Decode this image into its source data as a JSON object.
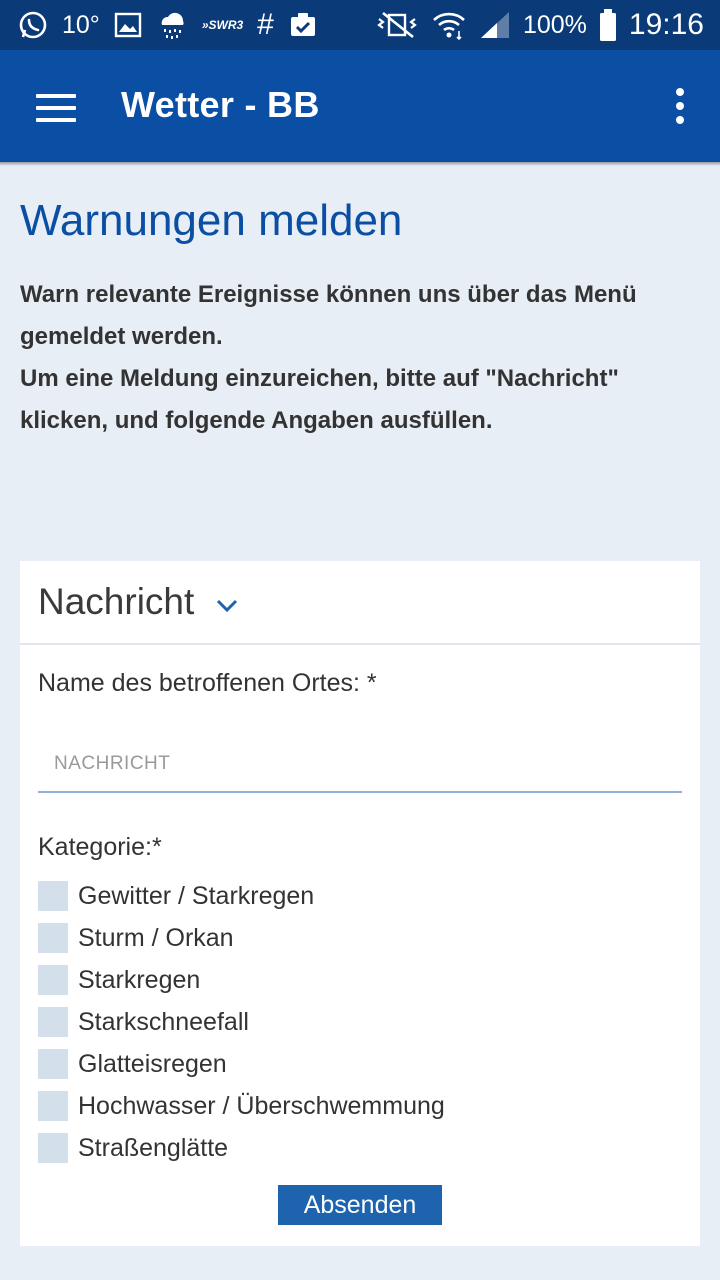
{
  "status_bar": {
    "temperature": "10°",
    "swr_label": "»SWR3",
    "hash": "#",
    "battery": "100%",
    "time": "19:16",
    "icons": [
      "whatsapp-icon",
      "gallery-icon",
      "weather-rain-icon",
      "swr3-icon",
      "hashtag-icon",
      "clipboard-check-icon",
      "vibrate-mute-icon",
      "wifi-icon",
      "signal-icon",
      "battery-icon"
    ]
  },
  "app_bar": {
    "title": "Wetter - BB",
    "menu_icon": "hamburger-menu-icon",
    "overflow_icon": "more-vertical-icon"
  },
  "page": {
    "heading": "Warnungen melden",
    "intro_line1": "Warn relevante Ereignisse können uns über das Menü gemeldet werden.",
    "intro_line2": "Um eine Meldung einzureichen, bitte auf  \"Nachricht\" klicken, und folgende Angaben ausfüllen."
  },
  "form": {
    "header": "Nachricht",
    "chevron_icon": "chevron-down-icon",
    "location_label": "Name des betroffenen Ortes: *",
    "location_placeholder": "NACHRICHT",
    "location_value": "",
    "category_label": "Kategorie:*",
    "categories": [
      {
        "label": "Gewitter / Starkregen",
        "checked": false
      },
      {
        "label": "Sturm / Orkan",
        "checked": false
      },
      {
        "label": "Starkregen",
        "checked": false
      },
      {
        "label": "Starkschneefall",
        "checked": false
      },
      {
        "label": "Glatteisregen",
        "checked": false
      },
      {
        "label": "Hochwasser / Überschwemmung",
        "checked": false
      },
      {
        "label": "Straßenglätte",
        "checked": false
      }
    ],
    "submit_label": "Absenden"
  },
  "colors": {
    "status_bar": "#0a3a78",
    "app_bar": "#0a4fa3",
    "heading": "#0a4fa3",
    "background": "#e8eef5",
    "button": "#1d63ad",
    "checkbox": "#d3e0ec"
  }
}
